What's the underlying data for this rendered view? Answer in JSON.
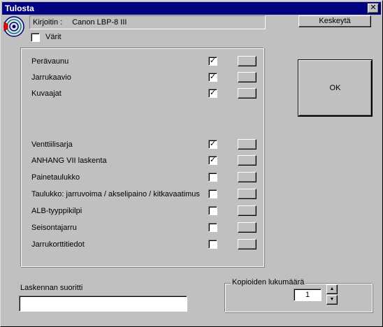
{
  "window": {
    "title": "Tulosta",
    "close_glyph": "✕"
  },
  "printer": {
    "label": "Kirjoitin :",
    "name": "Canon LBP-8 III"
  },
  "buttons": {
    "cancel": "Keskeytä",
    "ok": "OK"
  },
  "colors": {
    "label": "Värit",
    "checked": false
  },
  "items": [
    {
      "label": "Perävaunu",
      "checked": true,
      "mark": "✓"
    },
    {
      "label": "Jarrukaavio",
      "checked": true,
      "mark": "✓"
    },
    {
      "label": "Kuvaajat",
      "checked": true,
      "mark": "✓"
    },
    {
      "label": "Venttiilisarja",
      "checked": true,
      "mark": "✓"
    },
    {
      "label": "ANHANG VII laskenta",
      "checked": true,
      "mark": "✓"
    },
    {
      "label": "Painetaulukko",
      "checked": false,
      "mark": ""
    },
    {
      "label": "Taulukko:  jarruvoima / akselipaino / kitkavaatimus",
      "checked": false,
      "mark": ""
    },
    {
      "label": "ALB-tyyppikilpi",
      "checked": false,
      "mark": ""
    },
    {
      "label": "Seisontajarru",
      "checked": false,
      "mark": ""
    },
    {
      "label": "Jarrukorttitiedot",
      "checked": false,
      "mark": ""
    }
  ],
  "computed_by": {
    "label": "Laskennan suoritti",
    "value": ""
  },
  "copies": {
    "label": "Kopioiden lukumäärä",
    "value": "1",
    "up": "▲",
    "down": "▼"
  },
  "icons": {
    "printer": "printer-target-icon"
  }
}
